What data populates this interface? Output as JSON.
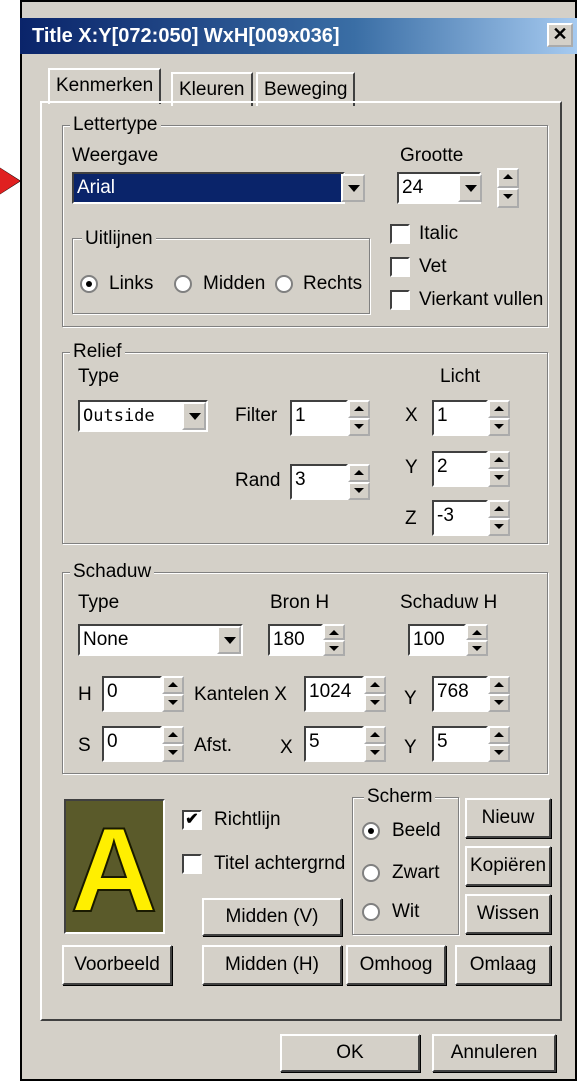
{
  "window": {
    "title": "Title   X:Y[072:050] WxH[009x036]",
    "close_label": "✕"
  },
  "tabs": [
    "Kenmerken",
    "Kleuren",
    "Beweging"
  ],
  "lettertype": {
    "legend": "Lettertype",
    "weergave_label": "Weergave",
    "font_value": "Arial",
    "grootte_label": "Grootte",
    "size_value": "24",
    "uitlijnen": {
      "legend": "Uitlijnen",
      "options": [
        "Links",
        "Midden",
        "Rechts"
      ],
      "selected": "Links"
    },
    "italic": {
      "label": "Italic",
      "checked": false
    },
    "vet": {
      "label": "Vet",
      "checked": false
    },
    "vierkant": {
      "label": "Vierkant vullen",
      "checked": false
    }
  },
  "relief": {
    "legend": "Relief",
    "type_label": "Type",
    "type_value": "Outside",
    "filter_label": "Filter",
    "filter_value": "1",
    "rand_label": "Rand",
    "rand_value": "3",
    "licht_label": "Licht",
    "x_label": "X",
    "x_value": "1",
    "y_label": "Y",
    "y_value": "2",
    "z_label": "Z",
    "z_value": "-3"
  },
  "schaduw": {
    "legend": "Schaduw",
    "type_label": "Type",
    "type_value": "None",
    "bron_label": "Bron H",
    "bron_value": "180",
    "schaduw_h_label": "Schaduw H",
    "schaduw_h_value": "100",
    "h_label": "H",
    "h_value": "0",
    "kantelen_label": "Kantelen X",
    "kantelen_x_value": "1024",
    "kantelen_y_label": "Y",
    "kantelen_y_value": "768",
    "s_label": "S",
    "s_value": "0",
    "afst_label": "Afst.",
    "afst_x_label": "X",
    "afst_x_value": "5",
    "afst_y_label": "Y",
    "afst_y_value": "5"
  },
  "bottom": {
    "preview_letter": "A",
    "richtlijn": {
      "label": "Richtlijn",
      "checked": true
    },
    "titel_achtergrnd": {
      "label": "Titel achtergrnd",
      "checked": false
    },
    "scherm": {
      "legend": "Scherm",
      "options": [
        "Beeld",
        "Zwart",
        "Wit"
      ],
      "selected": "Beeld"
    },
    "nieuw_label": "Nieuw",
    "kopieren_label": "Kopiëren",
    "wissen_label": "Wissen",
    "midden_v_label": "Midden (V)",
    "voorbeeld_label": "Voorbeeld",
    "midden_h_label": "Midden (H)",
    "omhoog_label": "Omhoog",
    "omlaag_label": "Omlaag"
  },
  "footer": {
    "ok_label": "OK",
    "annuleren_label": "Annuleren"
  },
  "check_mark": "✔"
}
